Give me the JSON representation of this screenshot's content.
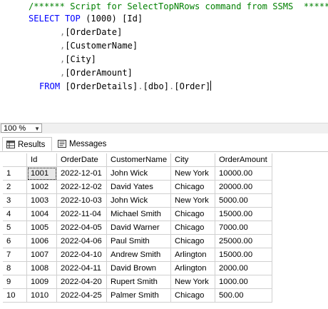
{
  "editor": {
    "comment": "/****** Script for SelectTopNRows command from SSMS  ******/",
    "select_keyword": "SELECT",
    "top_keyword": "TOP",
    "top_value": "(1000)",
    "first_column": "[Id]",
    "columns": [
      "[OrderDate]",
      "[CustomerName]",
      "[City]",
      "[OrderAmount]"
    ],
    "comma": ",",
    "from_keyword": "FROM",
    "table_part1": "[OrderDetails]",
    "table_part2": "[dbo]",
    "table_part3": "[Order]",
    "dot": "."
  },
  "zoom": {
    "value": "100 %"
  },
  "tabs": {
    "results": "Results",
    "messages": "Messages"
  },
  "grid": {
    "headers": [
      "Id",
      "OrderDate",
      "CustomerName",
      "City",
      "OrderAmount"
    ],
    "rows": [
      {
        "n": "1",
        "cells": [
          "1001",
          "2022-12-01",
          "John Wick",
          "New York",
          "10000.00"
        ]
      },
      {
        "n": "2",
        "cells": [
          "1002",
          "2022-12-02",
          "David Yates",
          "Chicago",
          "20000.00"
        ]
      },
      {
        "n": "3",
        "cells": [
          "1003",
          "2022-10-03",
          "John Wick",
          "New York",
          "5000.00"
        ]
      },
      {
        "n": "4",
        "cells": [
          "1004",
          "2022-11-04",
          "Michael Smith",
          "Chicago",
          "15000.00"
        ]
      },
      {
        "n": "5",
        "cells": [
          "1005",
          "2022-04-05",
          "David Warner",
          "Chicago",
          "7000.00"
        ]
      },
      {
        "n": "6",
        "cells": [
          "1006",
          "2022-04-06",
          "Paul Smith",
          "Chicago",
          "25000.00"
        ]
      },
      {
        "n": "7",
        "cells": [
          "1007",
          "2022-04-10",
          "Andrew Smith",
          "Arlington",
          "15000.00"
        ]
      },
      {
        "n": "8",
        "cells": [
          "1008",
          "2022-04-11",
          "David Brown",
          "Arlington",
          "2000.00"
        ]
      },
      {
        "n": "9",
        "cells": [
          "1009",
          "2022-04-20",
          "Rupert Smith",
          "New York",
          "1000.00"
        ]
      },
      {
        "n": "10",
        "cells": [
          "1010",
          "2022-04-25",
          "Palmer Smith",
          "Chicago",
          "500.00"
        ]
      }
    ]
  }
}
